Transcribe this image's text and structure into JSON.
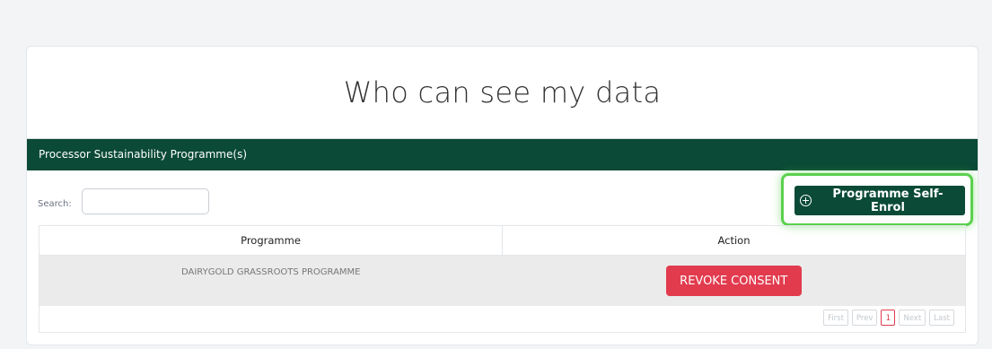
{
  "page": {
    "title": "Who can see my data"
  },
  "panel": {
    "header": "Processor Sustainability Programme(s)",
    "search_label": "Search:",
    "search_value": "",
    "enrol_button_label": "Programme Self-Enrol"
  },
  "table": {
    "columns": [
      "Programme",
      "Action"
    ],
    "rows": [
      {
        "programme": "DAIRYGOLD GRASSROOTS PROGRAMME",
        "action_label": "REVOKE CONSENT"
      }
    ]
  },
  "pagination": {
    "first": "First",
    "prev": "Prev",
    "current": "1",
    "next": "Next",
    "last": "Last"
  },
  "colors": {
    "brand_green": "#0b4a36",
    "danger_red": "#e23b4e",
    "highlight_green": "#5bd04e"
  },
  "icons": {
    "enrol": "plus-circle-icon"
  }
}
